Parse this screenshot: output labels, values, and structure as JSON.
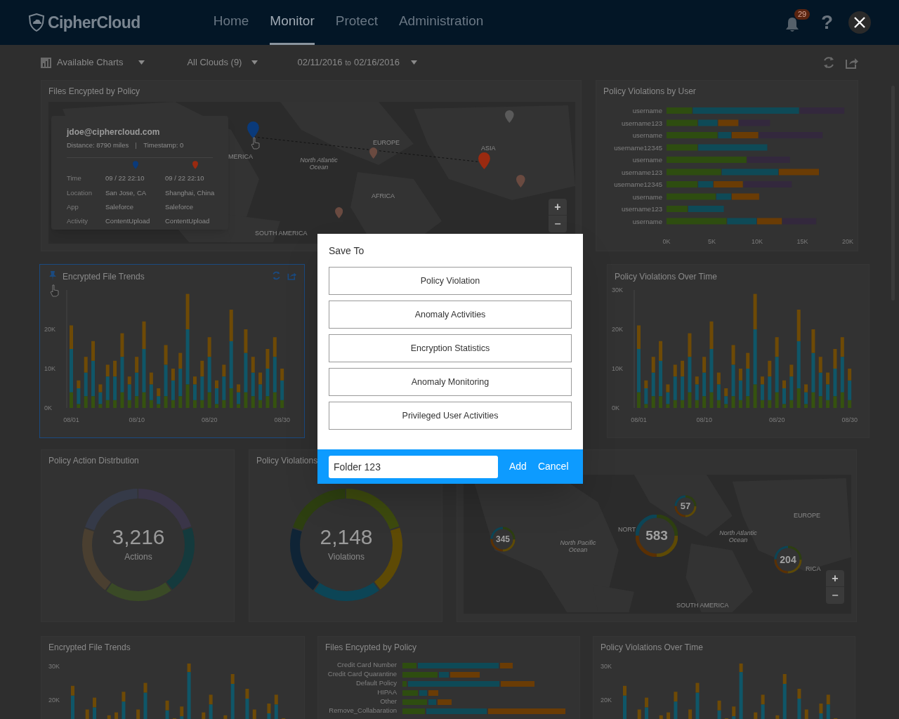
{
  "header": {
    "logo": "CipherCloud",
    "nav": [
      {
        "label": "Home",
        "selected": false
      },
      {
        "label": "Monitor",
        "selected": true
      },
      {
        "label": "Protect",
        "selected": false
      },
      {
        "label": "Administration",
        "selected": false
      }
    ],
    "notifications": "29",
    "help": "?"
  },
  "toolbar": {
    "charts_menu": "Available Charts",
    "clouds_menu": "All Clouds (9)",
    "date_from": "02/11/2016",
    "date_sep": "to",
    "date_to": "02/16/2016"
  },
  "files_map": {
    "title": "Files Encypted by Policy",
    "map_labels": [
      "MERICA",
      "EUROPE",
      "ASIA",
      "AFRICA",
      "SOUTH AMERICA",
      "North Atlantic Ocean"
    ],
    "zoom_in": "+",
    "zoom_out": "−",
    "tooltip": {
      "user": "jdoe@ciphercloud.com",
      "distance": "Distance: 8790 miles",
      "timestamp": "Timestamp: 0",
      "rows": [
        {
          "label": "Time",
          "from": "09 / 22 22:10",
          "to": "09 / 22 22:10"
        },
        {
          "label": "Location",
          "from": "San Jose, CA",
          "to": "Shanghai, China"
        },
        {
          "label": "App",
          "from": "Saleforce",
          "to": "Saleforce"
        },
        {
          "label": "Activity",
          "from": "ContentUpload",
          "to": "ContentUpload"
        }
      ]
    }
  },
  "violations_by_user": {
    "title": "Policy Violations by User",
    "chart_data": {
      "type": "bar",
      "orientation": "horizontal",
      "stacked": true,
      "categories": [
        "username",
        "username123",
        "username",
        "username12345",
        "username",
        "username123",
        "username12345",
        "username",
        "username123",
        "username"
      ],
      "series": [
        {
          "color": "#2e4d10",
          "values": [
            2.9,
            3.5,
            5.7,
            3.5,
            8.9,
            6.1,
            3.5,
            5.5,
            2.4,
            6.7
          ]
        },
        {
          "color": "#0e4a57",
          "values": [
            11.8,
            2.2,
            1.5,
            7.7,
            0,
            6.3,
            1.7,
            1.7,
            4.0,
            3.3
          ]
        },
        {
          "color": "#6a3c05",
          "values": [
            0,
            2.3,
            3.0,
            0,
            0,
            4.5,
            3.3,
            3.1,
            0,
            2.8
          ]
        },
        {
          "color": "#33283d",
          "values": [
            5.0,
            3.5,
            7.1,
            0,
            4.8,
            0,
            5.4,
            0,
            0,
            3.8
          ]
        }
      ],
      "xlim": [
        0,
        20
      ],
      "xticks": [
        {
          "value": 0,
          "label": "0K"
        },
        {
          "value": 5,
          "label": "5K"
        },
        {
          "value": 10,
          "label": "10K"
        },
        {
          "value": 15,
          "label": "15K"
        },
        {
          "value": 20,
          "label": "20K"
        }
      ]
    }
  },
  "trends": [
    {
      "title": "Encrypted File Trends",
      "highlighted": true,
      "chart_data": {
        "type": "bar",
        "stacked": true,
        "categories": [
          "08/01",
          null,
          null,
          null,
          null,
          null,
          null,
          null,
          null,
          "08/10",
          null,
          null,
          null,
          null,
          null,
          null,
          null,
          null,
          null,
          "08/20",
          null,
          null,
          null,
          null,
          null,
          null,
          null,
          null,
          null,
          "08/30"
        ],
        "series": [
          {
            "color": "#35520f",
            "values": [
              4,
              1,
              3,
              3,
              1,
              2,
              2,
              4,
              2,
              3,
              4,
              2,
              1,
              3,
              2,
              3,
              6,
              2,
              2,
              4,
              1,
              2,
              5,
              1,
              4,
              3,
              2,
              3,
              4,
              2
            ]
          },
          {
            "color": "#0f5668",
            "values": [
              11,
              4,
              6,
              9,
              3,
              6,
              6,
              9,
              4,
              6,
              11,
              4,
              2,
              8,
              5,
              7,
              14,
              4,
              6,
              9,
              4,
              6,
              12,
              3,
              10,
              6,
              4,
              7,
              9,
              5
            ]
          },
          {
            "color": "#6e4a06",
            "values": [
              6,
              2,
              4,
              5,
              2,
              3,
              4,
              6,
              2,
              4,
              7,
              3,
              2,
              5,
              3,
              4,
              9,
              2,
              4,
              5,
              2,
              3,
              8,
              2,
              6,
              4,
              3,
              5,
              5,
              3
            ]
          }
        ],
        "ylim": [
          0,
          30
        ],
        "yticks": [
          {
            "value": 0,
            "label": "0K"
          },
          {
            "value": 10,
            "label": "10K"
          },
          {
            "value": 20,
            "label": "20K"
          }
        ]
      }
    },
    {
      "title": "Policy Violations Over Time",
      "highlighted": false,
      "chart_data": {
        "type": "bar",
        "stacked": true,
        "categories": [
          "08/01",
          null,
          null,
          null,
          null,
          null,
          null,
          null,
          null,
          "08/10",
          null,
          null,
          null,
          null,
          null,
          null,
          null,
          null,
          null,
          "08/20",
          null,
          null,
          null,
          null,
          null,
          null,
          null,
          null,
          null,
          "08/30"
        ],
        "series": [
          {
            "color": "#35520f",
            "values": [
              4,
              1,
              3,
              3,
              1,
              2,
              2,
              4,
              2,
              3,
              4,
              2,
              1,
              3,
              2,
              3,
              6,
              2,
              2,
              4,
              1,
              2,
              5,
              1,
              4,
              3,
              2,
              3,
              4,
              2
            ]
          },
          {
            "color": "#0f5668",
            "values": [
              11,
              4,
              6,
              9,
              3,
              6,
              6,
              9,
              4,
              6,
              11,
              4,
              2,
              8,
              5,
              7,
              14,
              4,
              6,
              9,
              4,
              6,
              12,
              3,
              10,
              6,
              4,
              7,
              9,
              5
            ]
          },
          {
            "color": "#6e4a06",
            "values": [
              6,
              2,
              4,
              5,
              2,
              3,
              4,
              6,
              2,
              4,
              7,
              3,
              2,
              5,
              3,
              4,
              9,
              2,
              4,
              5,
              2,
              3,
              8,
              2,
              6,
              4,
              3,
              5,
              5,
              3
            ]
          }
        ],
        "ylim": [
          0,
          30
        ],
        "yticks": [
          {
            "value": 0,
            "label": "0K"
          },
          {
            "value": 10,
            "label": "10K"
          },
          {
            "value": 20,
            "label": "20K"
          },
          {
            "value": 30,
            "label": "30K"
          }
        ]
      }
    }
  ],
  "donuts": [
    {
      "title": "Policy Action Distrbution",
      "value": "3,216",
      "caption": "Actions"
    },
    {
      "title": "Policy Violations",
      "value": "2,148",
      "caption": "Violations"
    }
  ],
  "clusters_map": {
    "map_labels": [
      "NORT",
      "EUROPE",
      "North Pacific Ocean",
      "North Atlantic Ocean",
      "RICA",
      "SOUTH AMERICA"
    ],
    "clusters": [
      "345",
      "583",
      "57",
      "204"
    ],
    "zoom_in": "+",
    "zoom_out": "−"
  },
  "bottom_row": [
    {
      "title": "Encrypted File Trends",
      "y_labels": [
        "30K",
        "20K"
      ]
    },
    {
      "title": "Files Encypted by Policy",
      "policies": [
        "Credit Card Number",
        "Credit Card Quarantine",
        "Default Policy",
        "HIPAA",
        "Other",
        "Remove_Collabaration"
      ]
    },
    {
      "title": "Policy Violations Over Time",
      "y_labels": [
        "30K",
        "20K"
      ]
    }
  ],
  "dialog": {
    "title": "Save To",
    "options": [
      "Policy Violation",
      "Anomaly Activities",
      "Encryption Statistics",
      "Anomaly Monitoring",
      "Privileged User Activities"
    ],
    "folder_value": "Folder 123",
    "add": "Add",
    "cancel": "Cancel"
  }
}
